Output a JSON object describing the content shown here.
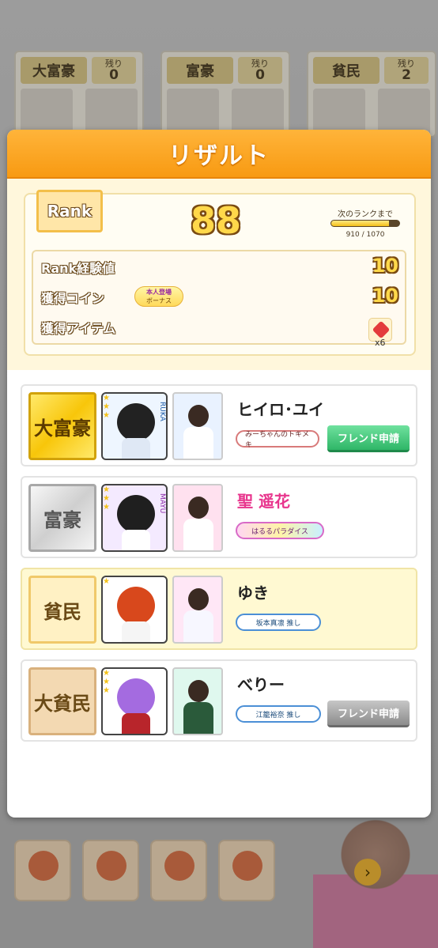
{
  "background": {
    "slots": [
      {
        "rank": "大富豪",
        "remaining_label": "残り",
        "remaining": "0"
      },
      {
        "rank": "富豪",
        "remaining_label": "残り",
        "remaining": "0"
      },
      {
        "rank": "貧民",
        "remaining_label": "残り",
        "remaining": "2"
      }
    ]
  },
  "modal": {
    "title": "リザルト",
    "rank_label": "Rank",
    "rank_value": "88",
    "next_rank_label": "次のランクまで",
    "next_rank_progress": "910 / 1070",
    "progress_fraction": 0.85,
    "stats": [
      {
        "label": "Rank経験値",
        "value": "10"
      },
      {
        "label": "獲得コイン",
        "value": "10",
        "bonus_top": "本人登場",
        "bonus_bottom": "ボーナス"
      },
      {
        "label": "獲得アイテム",
        "item_count": "x6"
      }
    ]
  },
  "players": [
    {
      "role": "大富豪",
      "name": "ヒイロ･ユイ",
      "tag": "みーちゃんのトキメキ",
      "button": "フレンド申請",
      "card_label": "RUKA"
    },
    {
      "role": "富豪",
      "name": "聖 遥花",
      "tag": "はるるパラダイス",
      "card_label": "MAYU"
    },
    {
      "role": "貧民",
      "name": "ゆき",
      "tag": "坂本真凛 推し"
    },
    {
      "role": "大貧民",
      "name": "べりー",
      "tag": "江籠裕奈 推し",
      "button": "フレンド申請"
    }
  ],
  "colors": {
    "accent": "#f89a12",
    "friend_green": "#2fb667",
    "friend_gray": "#8c8c8c",
    "name_pink": "#e8358d"
  }
}
